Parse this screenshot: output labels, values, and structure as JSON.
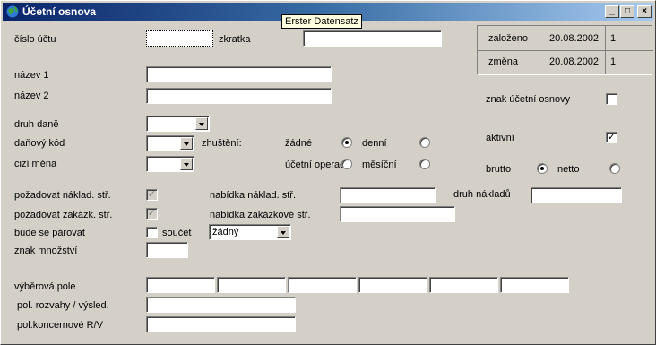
{
  "window": {
    "title": "Účetní osnova",
    "tooltip": "Erster Datensatz",
    "controls": {
      "minimize": "_",
      "maximize": "□",
      "close": "×"
    }
  },
  "info": {
    "created_label": "založeno",
    "created_date": "20.08.2002",
    "created_count": "1",
    "changed_label": "změna",
    "changed_date": "20.08.2002",
    "changed_count": "1"
  },
  "form": {
    "account_number": {
      "label": "číslo účtu",
      "value": ""
    },
    "abbreviation": {
      "label": "zkratka",
      "value": ""
    },
    "name1": {
      "label": "název 1",
      "value": ""
    },
    "name2": {
      "label": "název 2",
      "value": ""
    },
    "chart_flag": {
      "label": "znak účetní osnovy",
      "checked": false
    },
    "tax_type": {
      "label": "druh daně",
      "value": ""
    },
    "tax_code": {
      "label": "daňový kód",
      "value": ""
    },
    "foreign_currency": {
      "label": "cizí měna",
      "value": ""
    },
    "compression": {
      "label": "zhuštění:",
      "options": [
        "žádné",
        "denní",
        "účetní operace",
        "měsíční"
      ],
      "selected": "žádné"
    },
    "active": {
      "label": "aktivní",
      "checked": true
    },
    "gross_net": {
      "options": [
        "brutto",
        "netto"
      ],
      "selected": "brutto"
    },
    "require_cost_center": {
      "label": "požadovat náklad. stř.",
      "checked": true
    },
    "offer_cost_center": {
      "label": "nabídka náklad. stř.",
      "value": ""
    },
    "cost_type": {
      "label": "druh nákladů",
      "value": ""
    },
    "require_order_center": {
      "label": "požadovat zakázk. stř.",
      "checked": true
    },
    "offer_order_center": {
      "label": "nabídka zakázkové stř.",
      "value": ""
    },
    "paired": {
      "label": "bude se párovat",
      "checked": false
    },
    "sum": {
      "label": "součet",
      "value": "žádný"
    },
    "quantity_flag": {
      "label": "znak množství",
      "value": ""
    },
    "selection_fields": {
      "label": "výběrová pole",
      "values": [
        "",
        "",
        "",
        "",
        "",
        ""
      ]
    },
    "balance_item": {
      "label": "pol. rozvahy /  výsled.",
      "value": ""
    },
    "group_item": {
      "label": "pol.koncernové R/V",
      "value": ""
    }
  }
}
